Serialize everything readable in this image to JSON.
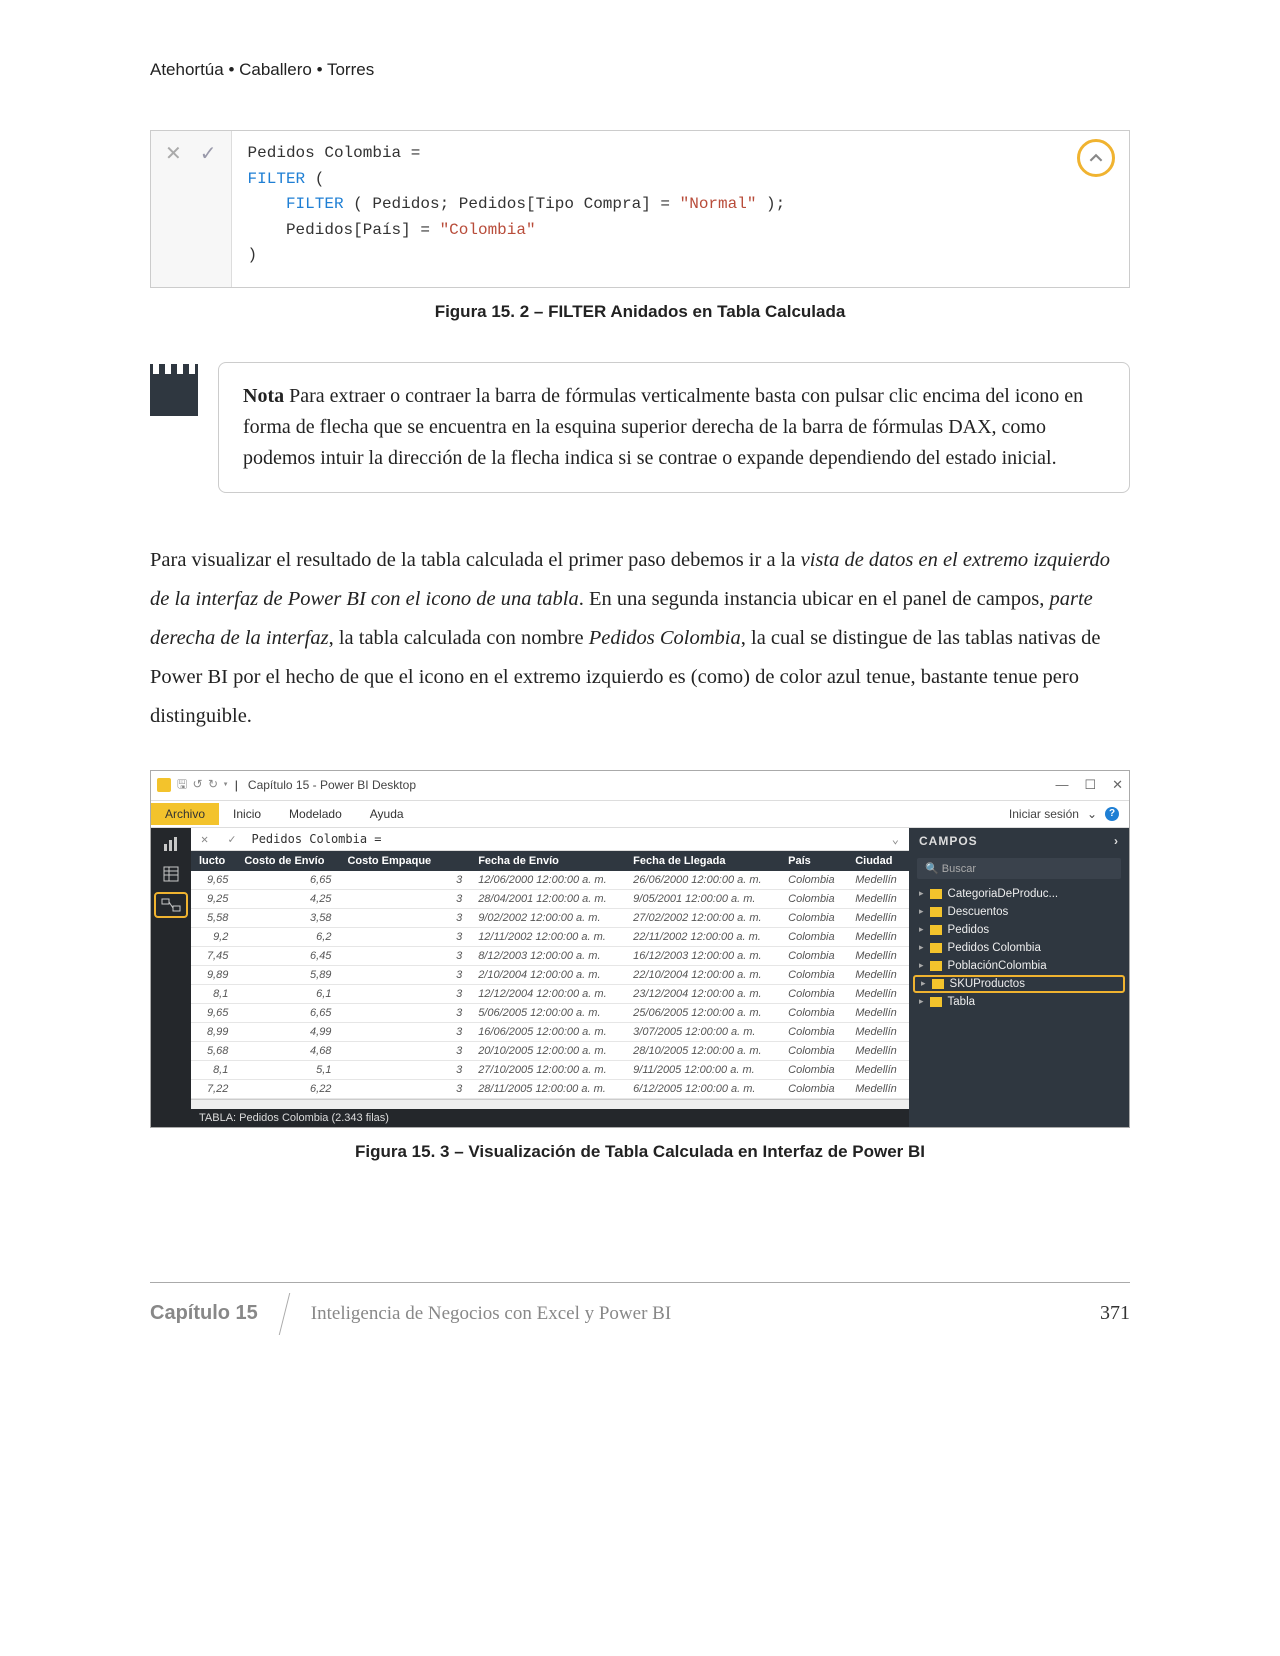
{
  "authors": "Atehortúa • Caballero • Torres",
  "dax": {
    "line1a": "Pedidos Colombia =",
    "line2_kw": "FILTER",
    "line2_rest": " (",
    "line3_kw": "FILTER",
    "line3_mid": " ( Pedidos; Pedidos[Tipo Compra] = ",
    "line3_str": "\"Normal\"",
    "line3_end": " );",
    "line4_mid": "Pedidos[País] = ",
    "line4_str": "\"Colombia\"",
    "line5": ")"
  },
  "fig1_caption": "Figura 15. 2 – FILTER Anidados en Tabla Calculada",
  "note": {
    "label": "Nota",
    "text": " Para extraer o contraer la barra de fórmulas verticalmente basta con pulsar clic encima del icono en forma de flecha que se encuentra en la esquina superior derecha de la barra de fórmulas DAX, como podemos intuir la dirección de la flecha indica si se contrae o expande dependiendo del estado inicial."
  },
  "para": {
    "t1": "Para visualizar el resultado de la tabla calculada el primer paso debemos ir a la ",
    "i1": "vista de datos en el extremo izquierdo de la interfaz de Power BI con el  icono de una tabla",
    "t2": ". En una segunda instancia ubicar en el panel de campos, ",
    "i2": "parte derecha de la interfaz",
    "t3": ", la tabla calculada con nombre ",
    "i3": "Pedidos Colombia",
    "t4": ", la cual se distingue de las tablas nativas de Power BI por el hecho de que el icono en el extremo izquierdo es (como) de color azul tenue, bastante tenue pero distinguible."
  },
  "pbi": {
    "title": "Capítulo 15 - Power BI Desktop",
    "qat_icons": "🖫 ↺ ↻ ▾",
    "tabs": [
      "Archivo",
      "Inicio",
      "Modelado",
      "Ayuda"
    ],
    "signin": "Iniciar sesión",
    "formula": "Pedidos Colombia =",
    "search": "Buscar",
    "panel_title": "CAMPOS",
    "fields": [
      "CategoriaDeProduc...",
      "Descuentos",
      "Pedidos",
      "Pedidos Colombia",
      "PoblaciónColombia",
      "SKUProductos",
      "Tabla"
    ],
    "status": "TABLA: Pedidos Colombia (2.343 filas)",
    "columns": [
      "lucto",
      "Costo de Envío",
      "Costo Empaque",
      "",
      "Fecha de Envío",
      "Fecha de Llegada",
      "País",
      "Ciudad"
    ],
    "rows": [
      [
        "9,65",
        "6,65",
        "3",
        "12/06/2000 12:00:00 a. m.",
        "26/06/2000 12:00:00 a. m.",
        "Colombia",
        "Medellín"
      ],
      [
        "9,25",
        "4,25",
        "3",
        "28/04/2001 12:00:00 a. m.",
        "9/05/2001 12:00:00 a. m.",
        "Colombia",
        "Medellín"
      ],
      [
        "5,58",
        "3,58",
        "3",
        "9/02/2002 12:00:00 a. m.",
        "27/02/2002 12:00:00 a. m.",
        "Colombia",
        "Medellín"
      ],
      [
        "9,2",
        "6,2",
        "3",
        "12/11/2002 12:00:00 a. m.",
        "22/11/2002 12:00:00 a. m.",
        "Colombia",
        "Medellín"
      ],
      [
        "7,45",
        "6,45",
        "3",
        "8/12/2003 12:00:00 a. m.",
        "16/12/2003 12:00:00 a. m.",
        "Colombia",
        "Medellín"
      ],
      [
        "9,89",
        "5,89",
        "3",
        "2/10/2004 12:00:00 a. m.",
        "22/10/2004 12:00:00 a. m.",
        "Colombia",
        "Medellín"
      ],
      [
        "8,1",
        "6,1",
        "3",
        "12/12/2004 12:00:00 a. m.",
        "23/12/2004 12:00:00 a. m.",
        "Colombia",
        "Medellín"
      ],
      [
        "9,65",
        "6,65",
        "3",
        "5/06/2005 12:00:00 a. m.",
        "25/06/2005 12:00:00 a. m.",
        "Colombia",
        "Medellín"
      ],
      [
        "8,99",
        "4,99",
        "3",
        "16/06/2005 12:00:00 a. m.",
        "3/07/2005 12:00:00 a. m.",
        "Colombia",
        "Medellín"
      ],
      [
        "5,68",
        "4,68",
        "3",
        "20/10/2005 12:00:00 a. m.",
        "28/10/2005 12:00:00 a. m.",
        "Colombia",
        "Medellín"
      ],
      [
        "8,1",
        "5,1",
        "3",
        "27/10/2005 12:00:00 a. m.",
        "9/11/2005 12:00:00 a. m.",
        "Colombia",
        "Medellín"
      ],
      [
        "7,22",
        "6,22",
        "3",
        "28/11/2005 12:00:00 a. m.",
        "6/12/2005 12:00:00 a. m.",
        "Colombia",
        "Medellín"
      ]
    ]
  },
  "fig2_caption": "Figura 15. 3 – Visualización de Tabla Calculada en Interfaz de Power BI",
  "footer": {
    "chapter": "Capítulo 15",
    "book": "Inteligencia de Negocios con Excel y Power BI",
    "page": "371"
  }
}
